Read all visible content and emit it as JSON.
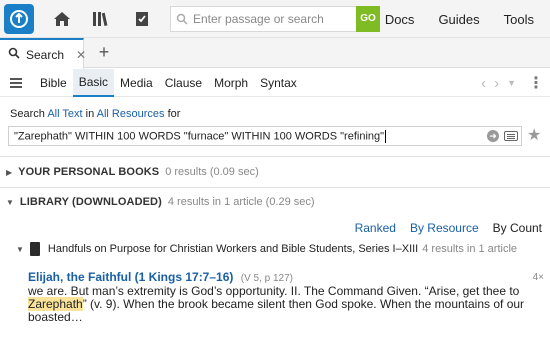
{
  "topbar": {
    "search_placeholder": "Enter passage or search",
    "go_label": "GO",
    "links": [
      "Docs",
      "Guides",
      "Tools"
    ]
  },
  "tabs": [
    {
      "label": "Search",
      "close": "✕"
    }
  ],
  "add_tab": "+",
  "kinds": [
    "Bible",
    "Basic",
    "Media",
    "Clause",
    "Morph",
    "Syntax"
  ],
  "active_kind": "Basic",
  "scope": {
    "prefix": "Search",
    "text_scope": "All Text",
    "in": "in",
    "resource_scope": "All Resources",
    "suffix": "for"
  },
  "query": "\"Zarephath\" WITHIN 100 WORDS \"furnace\" WITHIN 100 WORDS \"refining\"",
  "groups": [
    {
      "name": "YOUR PERSONAL BOOKS",
      "count": "0 results (0.09 sec)"
    },
    {
      "name": "LIBRARY (DOWNLOADED)",
      "count": "4 results in 1 article (0.29 sec)"
    }
  ],
  "sort": {
    "ranked": "Ranked",
    "by_resource": "By Resource",
    "by_count": "By Count"
  },
  "resource": {
    "title": "Handfuls on Purpose for Christian Workers and Bible Students, Series I–XIII",
    "count": "4 results in 1 article"
  },
  "hit": {
    "title": "Elijah, the Faithful (1 Kings 17:7–16)",
    "ref": "(V 5, p 127)",
    "count": "4×",
    "snippet_before": "we are. But man’s extremity is God’s opportunity. II. The Command Given. “Arise, get thee to ",
    "snippet_highlight": "Zarephath",
    "snippet_after": "” (v. 9). When the brook became silent then God spoke. When the mountains of our boasted…"
  },
  "colors": {
    "accent": "#1a7fc6",
    "go": "#7fbb22",
    "link": "#1a5fa6",
    "highlight": "#fbe49a"
  }
}
